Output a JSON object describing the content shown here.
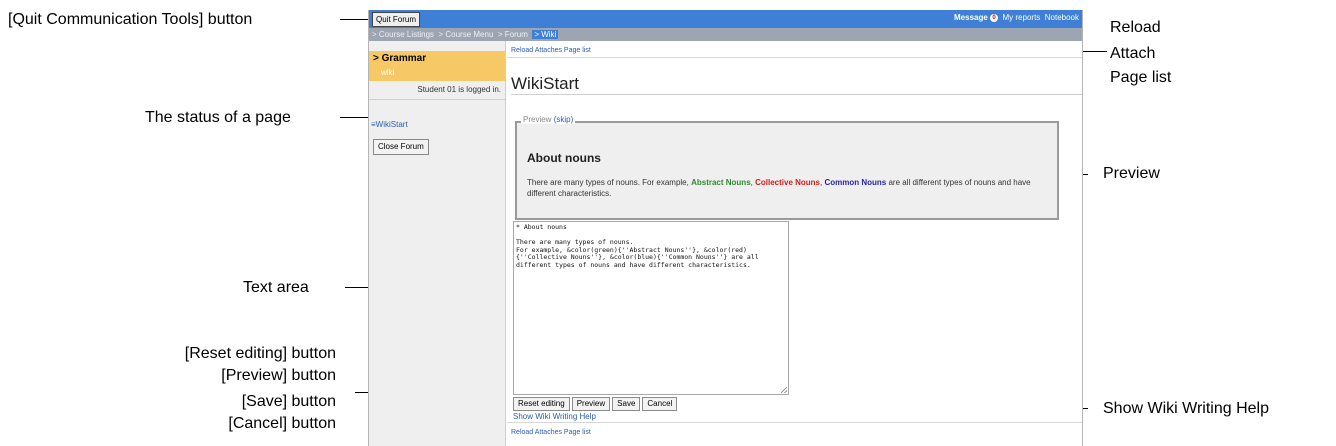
{
  "app": {
    "quit_button": "Quit Forum",
    "top_links": {
      "message": "Message",
      "message_count": "0",
      "my_reports": "My reports",
      "notebook": "Notebook"
    },
    "breadcrumb": [
      "> Course Listings",
      "> Course Menu",
      "> Forum",
      "> Wiki"
    ],
    "sidebar": {
      "course_title": "> Grammar",
      "course_subtitle": "wiki",
      "login_status": "Student 01 is logged in.",
      "page_link": "WikiStart",
      "close_forum_button": "Close Forum"
    },
    "main": {
      "reload_top": "Reload Attaches Page list",
      "page_title": "WikiStart",
      "preview": {
        "legend": "Preview",
        "skip": "(skip)",
        "heading": "About nouns",
        "body_before": "There are many types of nouns. For example, ",
        "abstract": "Abstract Nouns",
        "sep1": ", ",
        "collective": "Collective Nouns",
        "sep2": ", ",
        "common": "Common Nouns",
        "body_after": " are all different types of nouns and have different characteristics."
      },
      "textarea_value": "* About nouns\n\nThere are many types of nouns.\nFor example, &color(green){''Abstract Nouns''}, &color(red)\n{''Collective Nouns''}, &color(blue){''Common Nouns''} are all\ndifferent types of nouns and have different characteristics.",
      "buttons": {
        "reset": "Reset editing",
        "preview": "Preview",
        "save": "Save",
        "cancel": "Cancel"
      },
      "wiki_help": "Show Wiki Writing Help",
      "reload_bottom": "Reload Attaches Page list"
    }
  },
  "callouts": {
    "quit": "[Quit Communication Tools] button",
    "status": "The status of a page",
    "text_area": "Text area",
    "reset": "[Reset editing] button",
    "preview_btn": "[Preview] button",
    "save": "[Save] button",
    "cancel": "[Cancel] button",
    "reload_1": "Reload",
    "reload_2": "Attach",
    "reload_3": "Page list",
    "preview": "Preview",
    "wiki_help": "Show Wiki Writing Help"
  }
}
